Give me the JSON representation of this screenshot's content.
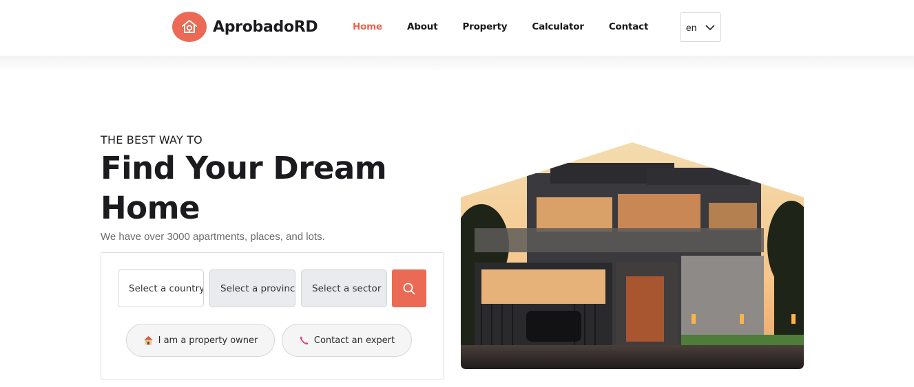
{
  "brand": {
    "name": "AprobadoRD"
  },
  "nav": {
    "items": [
      {
        "label": "Home",
        "active": true
      },
      {
        "label": "About",
        "active": false
      },
      {
        "label": "Property",
        "active": false
      },
      {
        "label": "Calculator",
        "active": false
      },
      {
        "label": "Contact",
        "active": false
      }
    ]
  },
  "language": {
    "value": "en"
  },
  "hero": {
    "eyebrow": "THE BEST WAY TO",
    "title": "Find Your Dream Home",
    "subtitle": "We have over 3000 apartments, places, and lots."
  },
  "search": {
    "country_placeholder": "Select a country",
    "province_placeholder": "Select a province",
    "sector_placeholder": "Select a sector",
    "button_icon": "search-icon"
  },
  "actions": {
    "owner_label": "I am a property owner",
    "owner_icon": "house-emoji-icon",
    "expert_label": "Contact an expert",
    "expert_icon": "phone-icon"
  },
  "colors": {
    "accent": "#ea6a55",
    "text": "#1b1b1f",
    "muted": "#6b6b70"
  }
}
